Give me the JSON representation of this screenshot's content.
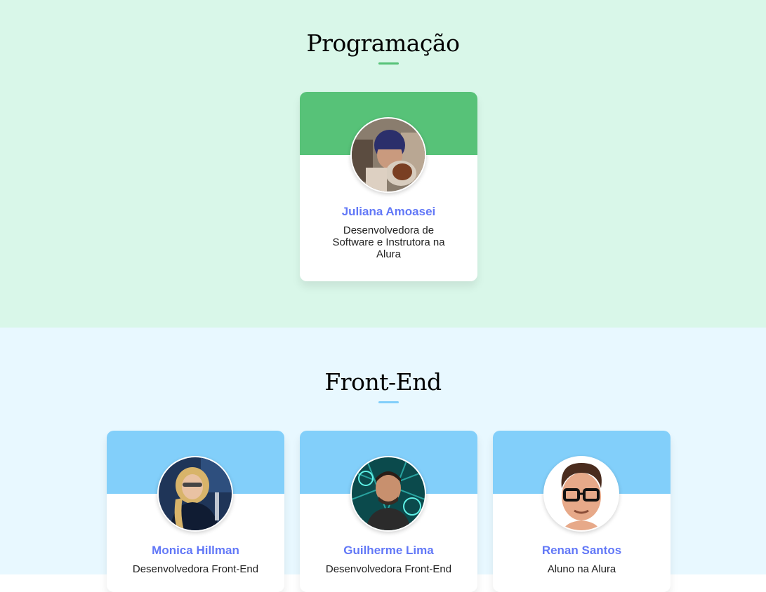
{
  "colors": {
    "prog_bg": "#d9f7e9",
    "prog_accent": "#57c278",
    "front_bg": "#e8f8ff",
    "front_accent": "#82cffa",
    "name_color": "#6278f7"
  },
  "sections": [
    {
      "title": "Programação",
      "cards": [
        {
          "name": "Juliana Amoasei",
          "role": "Desenvolvedora de Software e Instrutora na Alura",
          "avatar": "photo-avatar"
        }
      ]
    },
    {
      "title": "Front-End",
      "cards": [
        {
          "name": "Monica Hillman",
          "role": "Desenvolvedora Front-End",
          "avatar": "photo-avatar"
        },
        {
          "name": "Guilherme Lima",
          "role": "Desenvolvedora Front-End",
          "avatar": "photo-avatar"
        },
        {
          "name": "Renan Santos",
          "role": "Aluno na Alura",
          "avatar": "memoji-avatar"
        }
      ]
    }
  ]
}
